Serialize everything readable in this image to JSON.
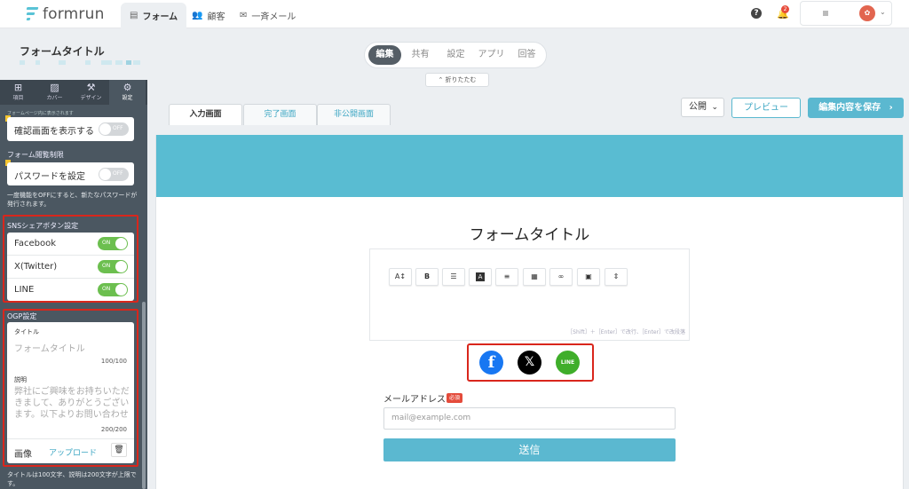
{
  "brand": {
    "name": "formrun"
  },
  "nav": {
    "tabs": [
      {
        "icon": "form-icon",
        "label": "フォーム",
        "active": true
      },
      {
        "icon": "customers-icon",
        "label": "顧客",
        "active": false
      },
      {
        "icon": "mail-icon",
        "label": "一斉メール",
        "active": false
      }
    ],
    "help": "?",
    "notification_count": "2"
  },
  "titlebar": {
    "form_title": "フォームタイトル",
    "modes": [
      {
        "label": "編集",
        "active": true
      },
      {
        "label": "共有",
        "active": false
      },
      {
        "label": "設定",
        "active": false
      },
      {
        "label": "アプリ",
        "active": false
      },
      {
        "label": "回答",
        "active": false
      }
    ],
    "collapse_label": "⌃ 折りたたむ"
  },
  "sidebar": {
    "tabs": [
      {
        "icon": "plus-square-icon",
        "label": "項目"
      },
      {
        "icon": "image-icon",
        "label": "カバー"
      },
      {
        "icon": "wrench-icon",
        "label": "デザイン"
      },
      {
        "icon": "gear-icon",
        "label": "設定"
      }
    ],
    "truncated_note": "フォームページ内に表示されます",
    "confirm_screen": {
      "label": "確認画面を表示する",
      "state": "OFF"
    },
    "access_limit": {
      "heading": "フォーム閲覧制限",
      "password_label": "パスワードを設定",
      "state": "OFF",
      "note": "一度機能をOFFにすると、新たなパスワードが発行されます。"
    },
    "sns": {
      "heading": "SNSシェアボタン設定",
      "items": [
        {
          "label": "Facebook",
          "state": "ON"
        },
        {
          "label": "X(Twitter)",
          "state": "ON"
        },
        {
          "label": "LINE",
          "state": "ON"
        }
      ]
    },
    "ogp": {
      "heading": "OGP設定",
      "title_label": "タイトル",
      "title_placeholder": "フォームタイトル",
      "title_count": "100/100",
      "desc_label": "説明",
      "desc_placeholder": "弊社にご興味をお持ちいただきまして、ありがとうございます。以下よりお問い合わせ",
      "desc_count": "200/200",
      "image_label": "画像",
      "upload_label": "アップロード"
    },
    "footer_note": "タイトルは100文字、説明は200文字が上限です。"
  },
  "main": {
    "form_tabs": [
      {
        "label": "入力画面",
        "active": true
      },
      {
        "label": "完了画面",
        "active": false
      },
      {
        "label": "非公開画面",
        "active": false
      }
    ],
    "publish_select": "公開",
    "preview_button": "プレビュー",
    "save_button": "編集内容を保存",
    "canvas_title": "フォームタイトル",
    "editor_toolbar": [
      {
        "icon": "font-size-icon",
        "glyph": "A↕"
      },
      {
        "icon": "bold-icon",
        "glyph": "B"
      },
      {
        "icon": "list-icon",
        "glyph": "☰"
      },
      {
        "icon": "text-color-icon",
        "glyph": "A"
      },
      {
        "icon": "align-icon",
        "glyph": "≡"
      },
      {
        "icon": "table-icon",
        "glyph": "▦"
      },
      {
        "icon": "link-icon",
        "glyph": "∞"
      },
      {
        "icon": "picture-icon",
        "glyph": "▣"
      },
      {
        "icon": "embed-icon",
        "glyph": "⇕"
      }
    ],
    "editor_hint": "［Shift］＋［Enter］で改行、［Enter］で改段落",
    "sns_buttons": [
      {
        "icon": "facebook-icon",
        "glyph": "f",
        "color": "#1877f2"
      },
      {
        "icon": "x-icon",
        "glyph": "𝕏",
        "color": "#000000"
      },
      {
        "icon": "line-icon",
        "glyph": "LINE",
        "color": "#3fae2a"
      }
    ],
    "email_label": "メールアドレス",
    "required_badge": "必須",
    "email_placeholder": "mail@example.com",
    "submit_label": "送信"
  },
  "colors": {
    "accent": "#5bb8d0",
    "sidebar_bg": "#4b5761",
    "toggle_on": "#6cbf4f",
    "highlight": "#d9261c"
  }
}
